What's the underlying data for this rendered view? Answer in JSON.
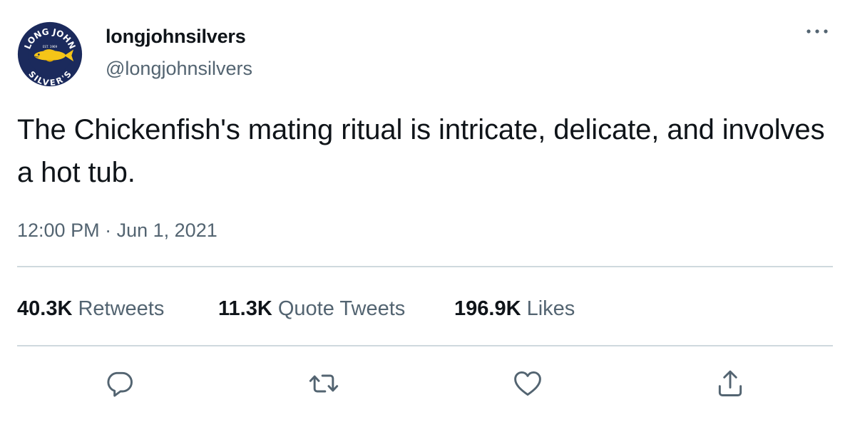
{
  "author": {
    "display_name": "longjohnsilvers",
    "handle": "@longjohnsilvers",
    "avatar": {
      "icon": "long-john-silvers-logo-icon",
      "text_top": "LONG JOHN",
      "text_est": "EST. 1969",
      "text_bottom": "SILVER'S",
      "colors": {
        "navy": "#1b2a5c",
        "fish": "#f5c518",
        "text": "#ffffff"
      }
    }
  },
  "more_icon": "more-horizontal-icon",
  "tweet": {
    "text": "The Chickenfish's mating ritual is intricate, delicate, and involves a hot tub.",
    "time": "12:00 PM",
    "separator": "·",
    "date": "Jun 1, 2021"
  },
  "stats": {
    "retweets": {
      "count": "40.3K",
      "label": "Retweets"
    },
    "quote_tweets": {
      "count": "11.3K",
      "label": "Quote Tweets"
    },
    "likes": {
      "count": "196.9K",
      "label": "Likes"
    }
  },
  "actions": [
    {
      "name": "reply",
      "icon": "reply-icon"
    },
    {
      "name": "retweet",
      "icon": "retweet-icon"
    },
    {
      "name": "like",
      "icon": "heart-icon"
    },
    {
      "name": "share",
      "icon": "share-icon"
    }
  ],
  "colors": {
    "primary_text": "#0f1419",
    "secondary_text": "#536471",
    "divider": "#cfd9de",
    "background": "#ffffff"
  }
}
